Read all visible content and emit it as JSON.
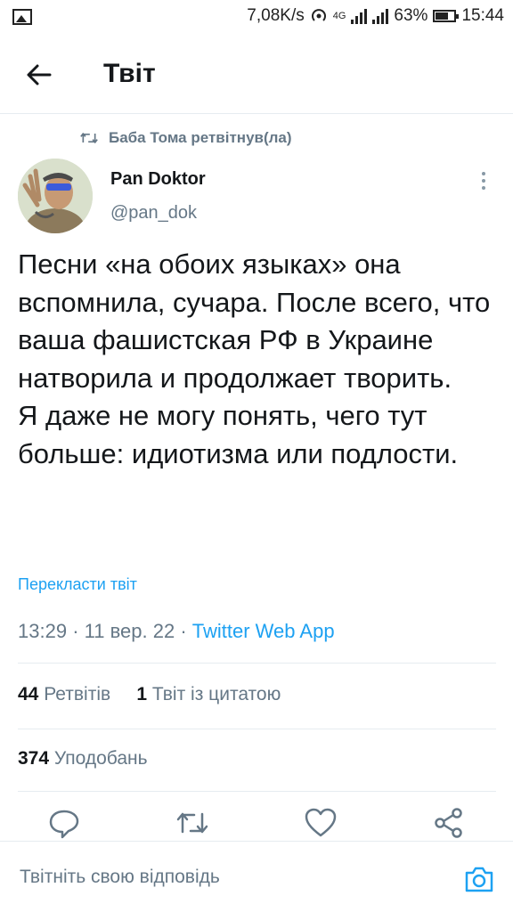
{
  "status_bar": {
    "speed": "7,08K/s",
    "network": "4G",
    "battery": "63%",
    "time": "15:44"
  },
  "header": {
    "title": "Твіт"
  },
  "retweet": {
    "text": "Баба Тома ретвітнув(ла)"
  },
  "author": {
    "name": "Pan Doktor",
    "handle": "@pan_dok"
  },
  "tweet": {
    "paragraph1": "Песни «на обоих языках» она вспомнила, сучара. После всего, что ваша фашистская РФ в Украине натворила и продолжает творить.",
    "paragraph2": "Я даже не могу понять, чего тут больше: идиотизма или подлости.",
    "translate_label": "Перекласти твіт",
    "time": "13:29",
    "date": "11 вер. 22",
    "source": "Twitter Web App"
  },
  "stats": {
    "retweets_count": "44",
    "retweets_label": "Ретвітів",
    "quotes_count": "1",
    "quotes_label": "Твіт із цитатою",
    "likes_count": "374",
    "likes_label": "Уподобань"
  },
  "reply": {
    "placeholder": "Твітніть свою відповідь"
  },
  "colors": {
    "accent": "#1da1f2",
    "secondary_text": "#657786",
    "divider": "#e6ecf0"
  }
}
